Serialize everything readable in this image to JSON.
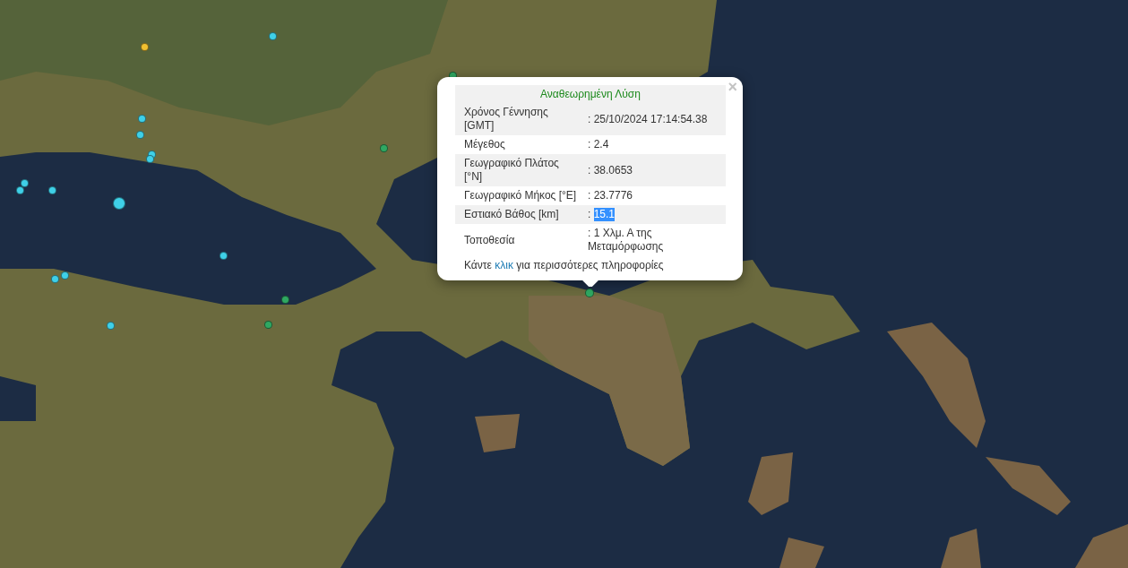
{
  "map": {
    "markers": [
      {
        "color": "#f0c030",
        "kind": "small"
      },
      {
        "color": "#3fd0e8",
        "kind": "small"
      },
      {
        "color": "#3fd0e8",
        "kind": "small"
      },
      {
        "color": "#3fd0e8",
        "kind": "small"
      },
      {
        "color": "#3fd0e8",
        "kind": "small"
      },
      {
        "color": "#3fd0e8",
        "kind": "small"
      },
      {
        "color": "#3fd0e8",
        "kind": "small"
      },
      {
        "color": "#3fd0e8",
        "kind": "small"
      },
      {
        "color": "#3fd0e8",
        "kind": "small"
      },
      {
        "color": "#3fd0e8",
        "kind": "large"
      },
      {
        "color": "#3fd0e8",
        "kind": "small"
      },
      {
        "color": "#3fd0e8",
        "kind": "small"
      },
      {
        "color": "#3fd0e8",
        "kind": "small"
      },
      {
        "color": "#3fd0e8",
        "kind": "small"
      },
      {
        "color": "#2fa862",
        "kind": "small"
      },
      {
        "color": "#2fa862",
        "kind": "small"
      },
      {
        "color": "#2fa862",
        "kind": "small"
      },
      {
        "color": "#2fa862",
        "kind": "small"
      },
      {
        "color": "#2fa862",
        "kind": "small"
      }
    ]
  },
  "popup": {
    "title": "Αναθεωρημένη Λύση",
    "close": "×",
    "rows": [
      {
        "label": "Χρόνος Γέννησης [GMT]",
        "value": ": 25/10/2024 17:14:54.38",
        "highlighted": false
      },
      {
        "label": "Μέγεθος",
        "value": ": 2.4",
        "highlighted": false
      },
      {
        "label": "Γεωγραφικό Πλάτος [°N]",
        "value": ": 38.0653",
        "highlighted": false
      },
      {
        "label": "Γεωγραφικό Μήκος [°E]",
        "value": ": 23.7776",
        "highlighted": false
      },
      {
        "label": "Εστιακό Βάθος [km]",
        "value": ": 15.1",
        "highlighted": true
      },
      {
        "label": "Τοποθεσία",
        "value": ": 1 Χλμ. Α της Μεταμόρφωσης",
        "highlighted": false
      }
    ],
    "footer": {
      "before": "Κάντε ",
      "link": "κλικ",
      "after": " για περισσότερες πληροφορίες"
    }
  }
}
